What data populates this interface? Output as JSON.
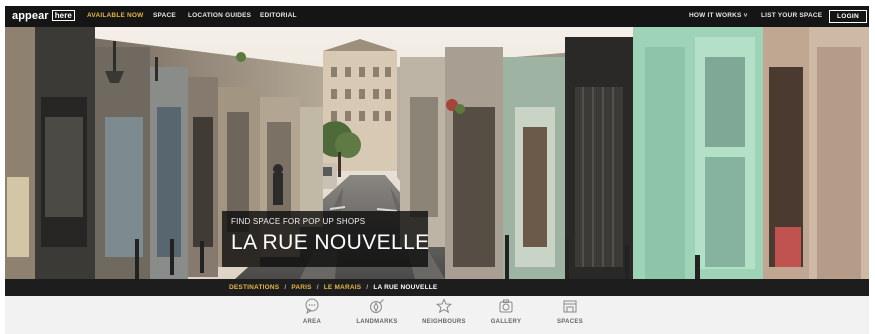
{
  "brand": {
    "logo_text": "appear",
    "logo_badge": "here"
  },
  "topnav": {
    "left_links": [
      "AVAILABLE NOW",
      "SPACE",
      "LOCATION GUIDES",
      "EDITORIAL"
    ],
    "right_links": [
      "HOW IT WORKS ˅",
      "LIST YOUR SPACE"
    ],
    "login_label": "LOGIN",
    "accent_color": "#e3b44c"
  },
  "hero": {
    "kicker": "FIND SPACE FOR POP UP SHOPS",
    "title": "LA RUE NOUVELLE"
  },
  "breadcrumb": {
    "separator": "/",
    "items": [
      "DESTINATIONS",
      "PARIS",
      "LE MARAIS",
      "LA RUE NOUVELLE"
    ]
  },
  "sections": [
    {
      "label": "AREA",
      "icon": "speech-bubble-icon"
    },
    {
      "label": "LANDMARKS",
      "icon": "compass-icon"
    },
    {
      "label": "NEIGHBOURS",
      "icon": "star-icon"
    },
    {
      "label": "GALLERY",
      "icon": "camera-icon"
    },
    {
      "label": "SPACES",
      "icon": "storefront-icon"
    }
  ]
}
